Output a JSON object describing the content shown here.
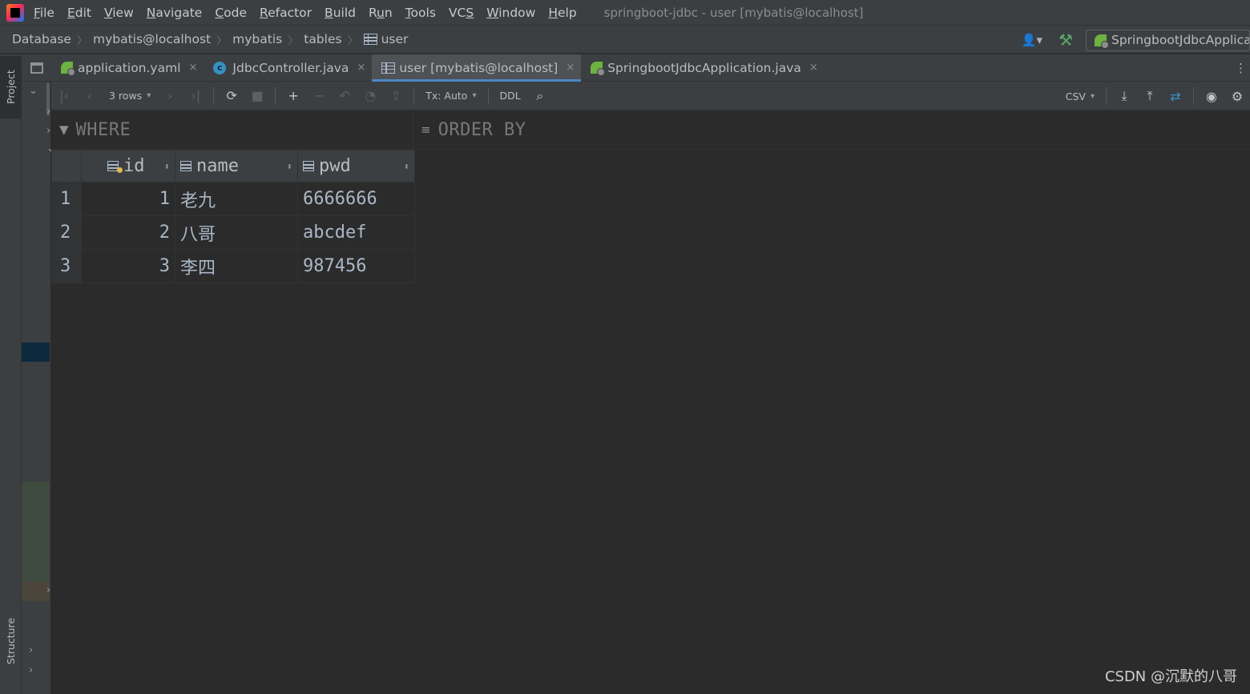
{
  "menubar": {
    "items": [
      {
        "pre": "",
        "u": "F",
        "post": "ile"
      },
      {
        "pre": "",
        "u": "E",
        "post": "dit"
      },
      {
        "pre": "",
        "u": "V",
        "post": "iew"
      },
      {
        "pre": "",
        "u": "N",
        "post": "avigate"
      },
      {
        "pre": "",
        "u": "C",
        "post": "ode"
      },
      {
        "pre": "",
        "u": "R",
        "post": "efactor"
      },
      {
        "pre": "",
        "u": "B",
        "post": "uild"
      },
      {
        "pre": "R",
        "u": "u",
        "post": "n"
      },
      {
        "pre": "",
        "u": "T",
        "post": "ools"
      },
      {
        "pre": "VC",
        "u": "S",
        "post": ""
      },
      {
        "pre": "",
        "u": "W",
        "post": "indow"
      },
      {
        "pre": "",
        "u": "H",
        "post": "elp"
      }
    ],
    "window_title": "springboot-jdbc - user [mybatis@localhost]"
  },
  "breadcrumb": {
    "items": [
      "Database",
      "mybatis@localhost",
      "mybatis",
      "tables",
      "user"
    ],
    "run_config": "SpringbootJdbcApplication"
  },
  "tabs": [
    {
      "label": "application.yaml",
      "icon": "spring-config-icon"
    },
    {
      "label": "JdbcController.java",
      "icon": "java-class-icon"
    },
    {
      "label": "user [mybatis@localhost]",
      "icon": "table-icon",
      "active": true
    },
    {
      "label": "SpringbootJdbcApplication.java",
      "icon": "spring-boot-icon"
    }
  ],
  "tab_close_glyph": "×",
  "left_strip": {
    "project": "Project",
    "structure": "Structure"
  },
  "toolbar": {
    "rows_label": "3 rows",
    "tx_label": "Tx: Auto",
    "ddl_label": "DDL",
    "export_format": "CSV"
  },
  "filter": {
    "where": "WHERE",
    "order_by": "ORDER BY"
  },
  "grid": {
    "columns": [
      "id",
      "name",
      "pwd"
    ],
    "rows": [
      {
        "num": "1",
        "id": "1",
        "name": "老九",
        "pwd": "6666666"
      },
      {
        "num": "2",
        "id": "2",
        "name": "八哥",
        "pwd": "abcdef"
      },
      {
        "num": "3",
        "id": "3",
        "name": "李四",
        "pwd": "987456"
      }
    ]
  },
  "watermark": "CSDN @沉默的八哥",
  "colors": {
    "accent": "#4a88c7",
    "background": "#2b2b2b",
    "panel": "#3c3f41"
  }
}
